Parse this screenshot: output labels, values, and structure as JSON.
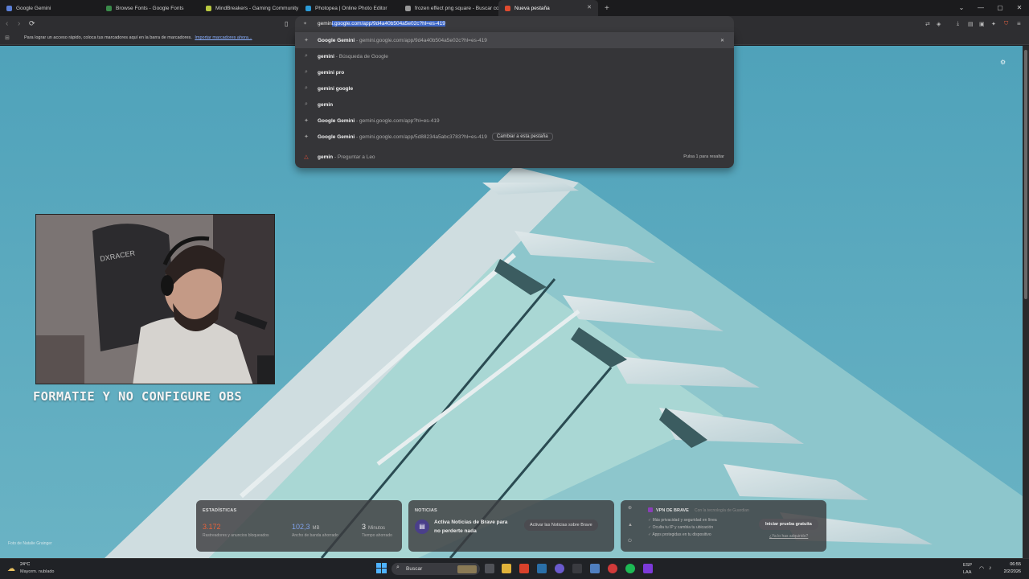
{
  "tabs": [
    {
      "label": "Google Gemini",
      "color": "#5b7fd6"
    },
    {
      "label": "Browse Fonts - Google Fonts",
      "color": "#3a8a4a"
    },
    {
      "label": "MindBreakers - Gaming Community",
      "color": "#b9c940"
    },
    {
      "label": "Photopea | Online Photo Editor",
      "color": "#2b9bd8"
    },
    {
      "label": "frozen effect png square - Buscar co",
      "color": "#999999"
    },
    {
      "label": "Nueva pestaña",
      "color": "#e04b2f",
      "active": true
    }
  ],
  "window_controls": [
    "chevron-down-icon",
    "minimize-icon",
    "maximize-icon",
    "close-icon"
  ],
  "omnibox": {
    "typed": "gemin",
    "highlighted": "i.google.com/app/9d4a40b504a5e02c?hl=es-419"
  },
  "bookmarks": {
    "message": "Para lograr un acceso rápido, coloca tus marcadores aquí en la barra de marcadores.",
    "import_link": "Importar marcadores ahora..."
  },
  "suggestions": [
    {
      "icon": "gemini-icon",
      "bold": "Google Gemini",
      "rest": " - gemini.google.com/app/9d4a40b504a5e02c?hl=es-419",
      "selected": true
    },
    {
      "icon": "search-icon",
      "bold": "gemini",
      "rest": " - Búsqueda de Google"
    },
    {
      "icon": "search-icon",
      "bold": "gemini pro",
      "rest": ""
    },
    {
      "icon": "search-icon",
      "bold": "gemini google",
      "rest": ""
    },
    {
      "icon": "search-icon",
      "bold": "gemin",
      "rest": ""
    },
    {
      "icon": "gemini-icon",
      "bold": "Google Gemini",
      "rest": " - gemini.google.com/app?hl=es-419"
    },
    {
      "icon": "gemini-icon",
      "bold": "Google Gemini",
      "rest": " - gemini.google.com/app/5d88234a5abc3783?hl=es-419",
      "chip": "Cambiar a esta pestaña"
    }
  ],
  "leo": {
    "bold": "gemin",
    "rest": " - Preguntar a Leo",
    "hint": "Pulsa 1 para resaltar"
  },
  "overlay_caption": "FORMATIE Y NO CONFIGURE OBS",
  "stats": {
    "header": "ESTADÍSTICAS",
    "items": [
      {
        "value": "3.172",
        "unit": "",
        "label": "Rastreadores y anuncios bloqueados",
        "color": "#e8623a"
      },
      {
        "value": "102,3",
        "unit": "MB",
        "label": "Ancho de banda ahorrado",
        "color": "#7fa0e8"
      },
      {
        "value": "3",
        "unit": "Minutos",
        "label": "Tiempo ahorrado",
        "color": "#e8e8e8"
      }
    ]
  },
  "news": {
    "header": "NOTICIAS",
    "title": "Activa Noticias de Brave para no perderte nada",
    "button": "Activar las Noticias sobre Brave"
  },
  "vpn": {
    "header": "VPN DE BRAVE",
    "sub": "Con la tecnología de",
    "brand": "Guardian",
    "features": [
      "Más privacidad y seguridad en línea",
      "Oculta tu IP y cambia tu ubicación",
      "Apps protegidas en tu dispositivo"
    ],
    "button": "Iniciar prueba gratuita",
    "link": "¿Ya lo has adquirido?"
  },
  "photo_credit": "Foto de Natalie Grainger",
  "taskbar": {
    "weather_temp": "24°C",
    "weather_desc": "Mayorm. nublado",
    "search_placeholder": "Buscar",
    "lang1": "ESP",
    "lang2": "LAA",
    "time": "06:55",
    "date": "2/2/2026"
  }
}
